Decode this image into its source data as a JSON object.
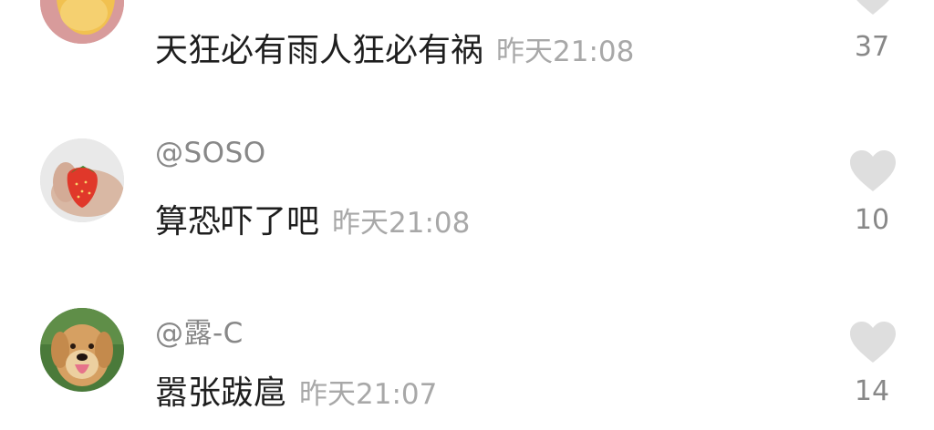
{
  "comments": [
    {
      "text": "天狂必有雨人狂必有祸",
      "time": "昨天21:08",
      "likes": "37",
      "avatar_icon": "avatar-icon"
    },
    {
      "username": "@SOSO",
      "text": "算恐吓了吧",
      "time": "昨天21:08",
      "likes": "10",
      "avatar_icon": "strawberry-avatar-icon"
    },
    {
      "username": "@露-C",
      "text": "嚣张跋扈",
      "time": "昨天21:07",
      "likes": "14",
      "avatar_icon": "dog-avatar-icon"
    }
  ],
  "colors": {
    "background": "#ffffff",
    "text": "#1e1e1e",
    "username": "#888888",
    "time": "#a8a8a8",
    "heart": "#dedede"
  }
}
